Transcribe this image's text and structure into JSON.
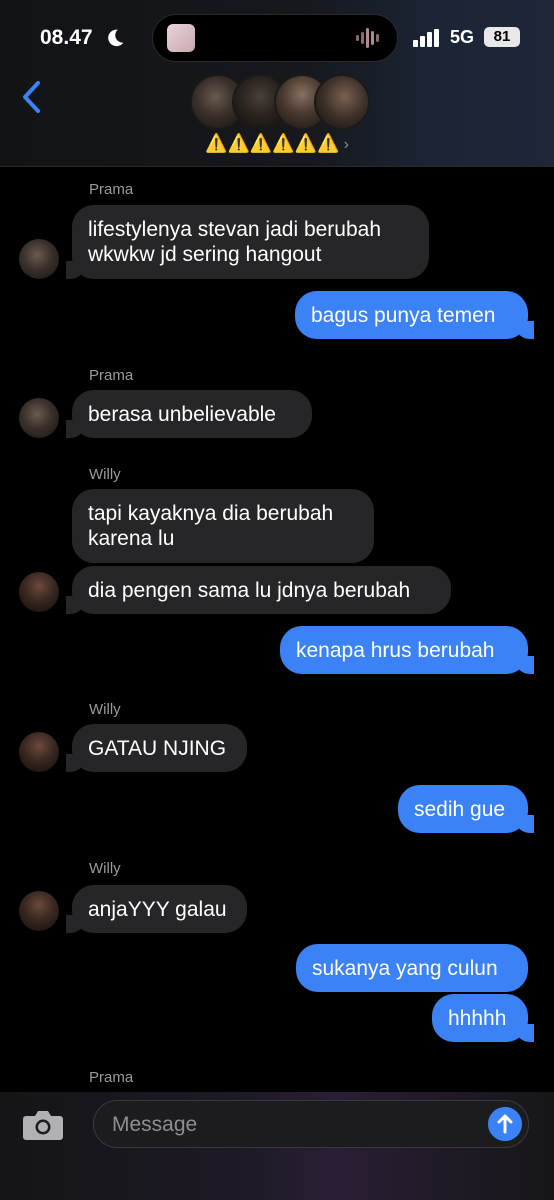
{
  "status": {
    "time": "08.47",
    "network": "5G",
    "battery": "81"
  },
  "header": {
    "group_name": "⚠️⚠️⚠️⚠️⚠️⚠️",
    "chevron": "›"
  },
  "messages": [
    {
      "sender": "Prama",
      "text_lines": [
        "lifestylenya stevan jadi berubah",
        "wkwkw jd sering hangout"
      ]
    },
    {
      "text": "bagus punya temen"
    },
    {
      "sender": "Prama",
      "text": "berasa unbelievable"
    },
    {
      "sender": "Willy",
      "text_lines": [
        "tapi kayaknya dia berubah",
        "karena lu"
      ]
    },
    {
      "text": "dia pengen sama lu jdnya berubah"
    },
    {
      "text": "kenapa hrus berubah"
    },
    {
      "sender": "Willy",
      "text": "GATAU NJING"
    },
    {
      "text": "sedih gue"
    },
    {
      "sender": "Willy",
      "text": "anjaYYY galau"
    },
    {
      "text": "sukanya yang culun"
    },
    {
      "text": "hhhhh"
    },
    {
      "sender": "Prama"
    }
  ],
  "composer": {
    "placeholder": "Message"
  }
}
